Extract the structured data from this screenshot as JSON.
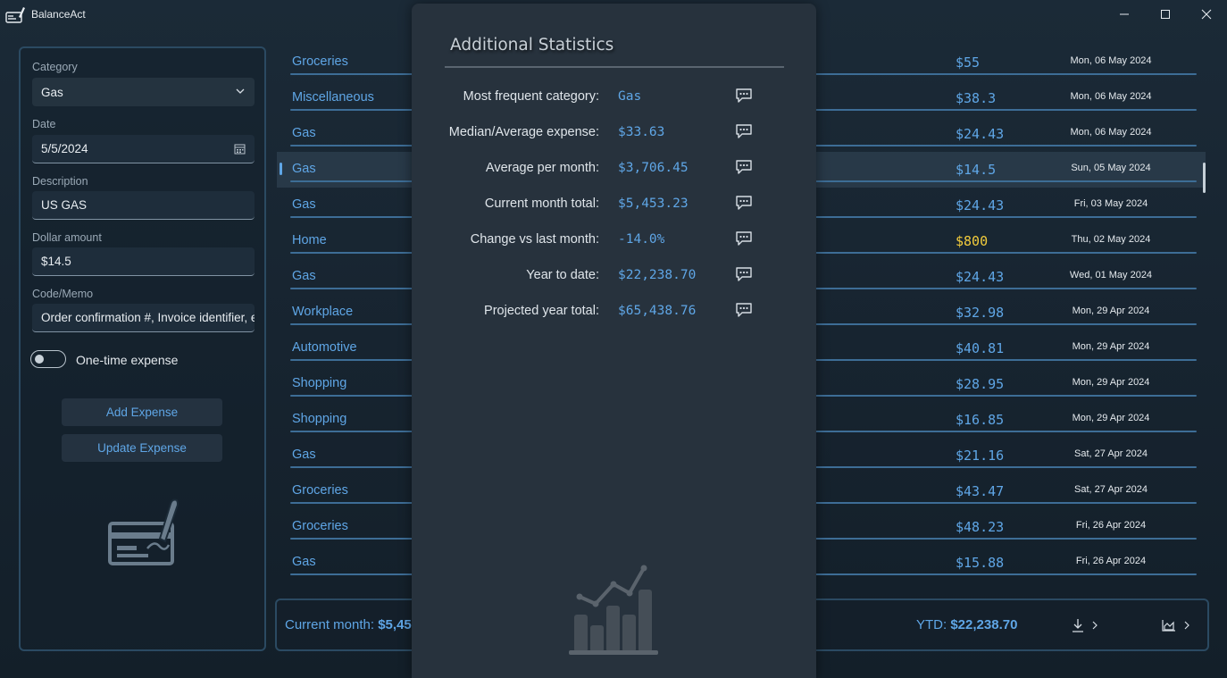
{
  "app": {
    "title": "BalanceAct"
  },
  "form": {
    "category_label": "Category",
    "category_value": "Gas",
    "date_label": "Date",
    "date_value": "5/5/2024",
    "description_label": "Description",
    "description_value": "US GAS",
    "amount_label": "Dollar amount",
    "amount_value": "$14.5",
    "memo_label": "Code/Memo",
    "memo_value": "Order confirmation #, Invoice identifier, etc.",
    "one_time_label": "One-time expense",
    "one_time_on": false,
    "add_button": "Add Expense",
    "update_button": "Update Expense"
  },
  "expenses": [
    {
      "category": "Groceries",
      "amount": "$55",
      "date": "Mon, 06 May 2024"
    },
    {
      "category": "Miscellaneous",
      "amount": "$38.3",
      "date": "Mon, 06 May 2024"
    },
    {
      "category": "Gas",
      "amount": "$24.43",
      "date": "Mon, 06 May 2024"
    },
    {
      "category": "Gas",
      "amount": "$14.5",
      "date": "Sun, 05 May 2024",
      "selected": true
    },
    {
      "category": "Gas",
      "amount": "$24.43",
      "date": "Fri, 03 May 2024"
    },
    {
      "category": "Home",
      "amount": "$800",
      "date": "Thu, 02 May 2024",
      "highlight": true
    },
    {
      "category": "Gas",
      "amount": "$24.43",
      "date": "Wed, 01 May 2024"
    },
    {
      "category": "Workplace",
      "amount": "$32.98",
      "date": "Mon, 29 Apr 2024"
    },
    {
      "category": "Automotive",
      "amount": "$40.81",
      "date": "Mon, 29 Apr 2024"
    },
    {
      "category": "Shopping",
      "amount": "$28.95",
      "date": "Mon, 29 Apr 2024"
    },
    {
      "category": "Shopping",
      "amount": "$16.85",
      "date": "Mon, 29 Apr 2024"
    },
    {
      "category": "Gas",
      "amount": "$21.16",
      "date": "Sat, 27 Apr 2024"
    },
    {
      "category": "Groceries",
      "amount": "$43.47",
      "date": "Sat, 27 Apr 2024"
    },
    {
      "category": "Groceries",
      "amount": "$48.23",
      "date": "Fri, 26 Apr 2024"
    },
    {
      "category": "Gas",
      "amount": "$15.88",
      "date": "Fri, 26 Apr 2024"
    }
  ],
  "summary": {
    "current_month_label": "Current month:",
    "current_month_value": "$5,45",
    "ytd_label": "YTD:",
    "ytd_value": "$22,238.70"
  },
  "stats": {
    "title": "Additional Statistics",
    "rows": [
      {
        "label": "Most frequent category:",
        "value": "Gas"
      },
      {
        "label": "Median/Average expense:",
        "value": "$33.63"
      },
      {
        "label": "Average per month:",
        "value": "$3,706.45"
      },
      {
        "label": "Current month total:",
        "value": "$5,453.23"
      },
      {
        "label": "Change vs last month:",
        "value": "-14.0%"
      },
      {
        "label": "Year to date:",
        "value": "$22,238.70"
      },
      {
        "label": "Projected year total:",
        "value": "$65,438.76"
      }
    ]
  },
  "colors": {
    "accent": "#5fa6e6",
    "highlight_amount": "#f2cc3c",
    "panel_border": "#2b4a62",
    "overlay_bg": "#27323d"
  },
  "icons": {
    "app": "check-pen-icon",
    "dropdown": "chevron-down-icon",
    "calendar": "calendar-icon",
    "stat_comment": "comment-icon",
    "export": "download-icon",
    "chart": "area-chart-icon"
  }
}
